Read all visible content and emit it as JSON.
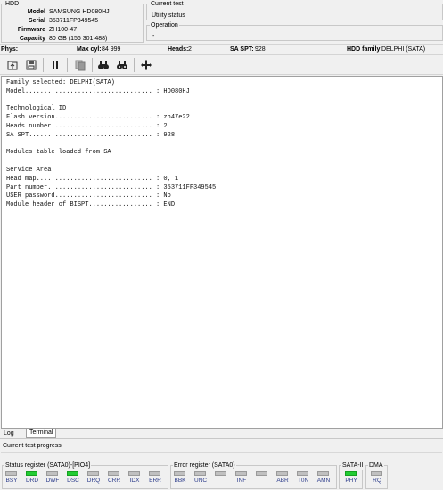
{
  "hdd": {
    "legend": "HDD",
    "rows": [
      {
        "key": "Model",
        "value": "SAMSUNG HD080HJ"
      },
      {
        "key": "Serial",
        "value": "353711FP349545"
      },
      {
        "key": "Firmware",
        "value": "ZH100-47"
      },
      {
        "key": "Capacity",
        "value": "80 GB (156 301 488)"
      }
    ]
  },
  "current_test": {
    "legend": "Current test",
    "status": "Utility status"
  },
  "operation": {
    "legend": "Operation",
    "value": "-"
  },
  "info_bar": {
    "phys_label": "Phys:",
    "maxcyl_label": "Max cyl:",
    "maxcyl_value": "84 999",
    "heads_label": "Heads:",
    "heads_value": "2",
    "spt_label": "SA SPT:",
    "spt_value": "928",
    "family_label": "HDD family:",
    "family_value": "DELPHI (SATA)"
  },
  "toolbar": {
    "icons": [
      "open-file-icon",
      "save-file-icon",
      "pause-icon",
      "copy-icon",
      "binoculars-icon",
      "binoculars-search-icon",
      "move-arrows-icon"
    ]
  },
  "log": {
    "lines": [
      "Family selected: DELPHI(SATA)",
      "Model.................................. : HD080HJ",
      "",
      "Technological ID",
      "Flash version.......................... : zh47e22",
      "Heads number........................... : 2",
      "SA SPT................................. : 928",
      "",
      "Modules table loaded from SA",
      "",
      "Service Area",
      "Head map............................... : 0, 1",
      "Part number............................ : 353711FF349545",
      "USER password.......................... : No",
      "Module header of BISPT................. : END"
    ]
  },
  "tabs": [
    {
      "label": "Log"
    },
    {
      "label": "Terminal"
    }
  ],
  "progress": {
    "label": "Current test progress"
  },
  "status_register": {
    "legend": "Status register (SATA0)-[PIO4]",
    "indicators": [
      {
        "label": "BSY",
        "on": false
      },
      {
        "label": "DRD",
        "on": true
      },
      {
        "label": "DWF",
        "on": false
      },
      {
        "label": "DSC",
        "on": true
      },
      {
        "label": "DRQ",
        "on": false
      },
      {
        "label": "CRR",
        "on": false
      },
      {
        "label": "IDX",
        "on": false
      },
      {
        "label": "ERR",
        "on": false
      }
    ]
  },
  "error_register": {
    "legend": "Error register (SATA0)",
    "indicators": [
      {
        "label": "BBK",
        "on": false
      },
      {
        "label": "UNC",
        "on": false
      },
      {
        "label": "",
        "on": false
      },
      {
        "label": "INF",
        "on": false
      },
      {
        "label": "",
        "on": false
      },
      {
        "label": "ABR",
        "on": false
      },
      {
        "label": "T0N",
        "on": false
      },
      {
        "label": "AMN",
        "on": false
      }
    ]
  },
  "sata_register": {
    "legend": "SATA-II",
    "indicators": [
      {
        "label": "PHY",
        "on": true
      }
    ]
  },
  "dma_register": {
    "legend": "DMA",
    "indicators": [
      {
        "label": "RQ",
        "on": false
      }
    ]
  },
  "colors": {
    "indicator_on": "#22cc33",
    "indicator_off": "#c0c0c0",
    "indicator_label": "#2a3a8a"
  }
}
